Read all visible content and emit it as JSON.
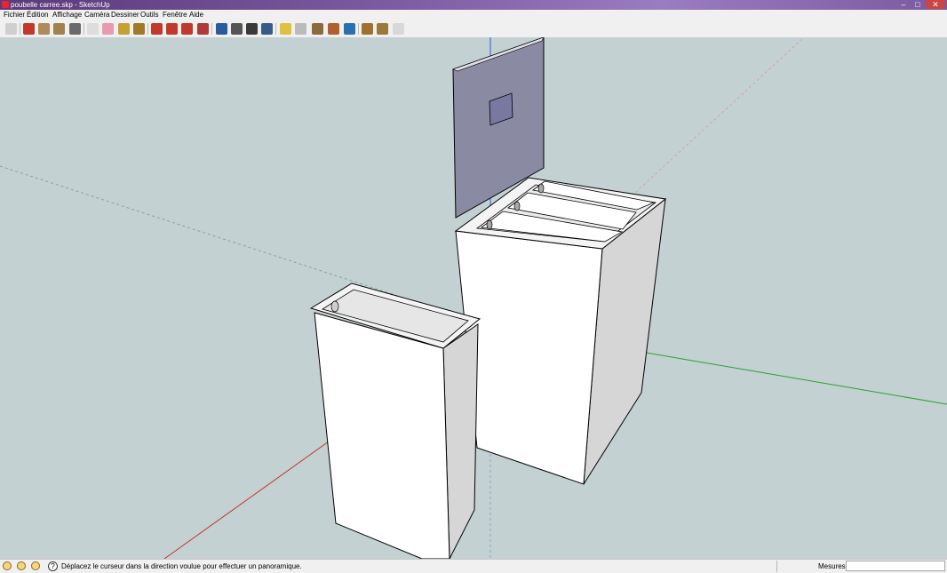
{
  "window": {
    "title": "poubelle carree.skp - SketchUp",
    "controls": {
      "minimize": "–",
      "maximize": "□",
      "close": "✕"
    }
  },
  "menu": {
    "items": [
      "Fichier",
      "Édition",
      "Affichage",
      "Caméra",
      "Dessiner",
      "Outils",
      "Fenêtre",
      "Aide"
    ]
  },
  "toolbar": {
    "tools": [
      {
        "name": "select-tool-icon",
        "color": "#cfcfcf"
      },
      {
        "name": "line-tool-icon",
        "color": "#c0392b"
      },
      {
        "name": "rectangle-tool-icon",
        "color": "#b08a5a"
      },
      {
        "name": "circle-tool-icon",
        "color": "#a0824a"
      },
      {
        "name": "arc-tool-icon",
        "color": "#6a6a6a"
      },
      {
        "name": "make-component-icon",
        "color": "#dddddd"
      },
      {
        "name": "eraser-tool-icon",
        "color": "#e79ab0"
      },
      {
        "name": "tape-measure-icon",
        "color": "#c6a032"
      },
      {
        "name": "paint-bucket-icon",
        "color": "#a07a2a"
      },
      {
        "name": "push-pull-icon",
        "color": "#c0392b"
      },
      {
        "name": "move-tool-icon",
        "color": "#c0392b"
      },
      {
        "name": "rotate-tool-icon",
        "color": "#c0392b"
      },
      {
        "name": "offset-tool-icon",
        "color": "#b03a3a"
      },
      {
        "name": "orbit-tool-icon",
        "color": "#2a5aa0"
      },
      {
        "name": "pan-tool-icon",
        "color": "#555555"
      },
      {
        "name": "zoom-tool-icon",
        "color": "#3a3a3a"
      },
      {
        "name": "zoom-extents-icon",
        "color": "#3a5a8a"
      },
      {
        "name": "add-location-icon",
        "color": "#e0c040"
      },
      {
        "name": "toggle-terrain-icon",
        "color": "#bbbbbb"
      },
      {
        "name": "google-earth-icon",
        "color": "#8a6a3a"
      },
      {
        "name": "photo-textures-icon",
        "color": "#b06030"
      },
      {
        "name": "share-model-icon",
        "color": "#2a70b0"
      },
      {
        "name": "get-models-icon",
        "color": "#a07030"
      },
      {
        "name": "share-component-icon",
        "color": "#9a7a3a"
      },
      {
        "name": "extension-warehouse-icon",
        "color": "#d8d8d8"
      }
    ]
  },
  "status": {
    "message": "Déplacez le curseur dans la direction voulue pour effectuer un panoramique.",
    "measurements_label": "Mesures",
    "help_icon": "?"
  },
  "colors": {
    "viewport_bg": "#c3d1d3",
    "lid": "#8a8aa3",
    "face_light": "#ffffff",
    "face_shade": "#d4d4d4",
    "axis_red": "#c0392b",
    "axis_green": "#2ca02c",
    "axis_blue": "#2a5ad4"
  }
}
